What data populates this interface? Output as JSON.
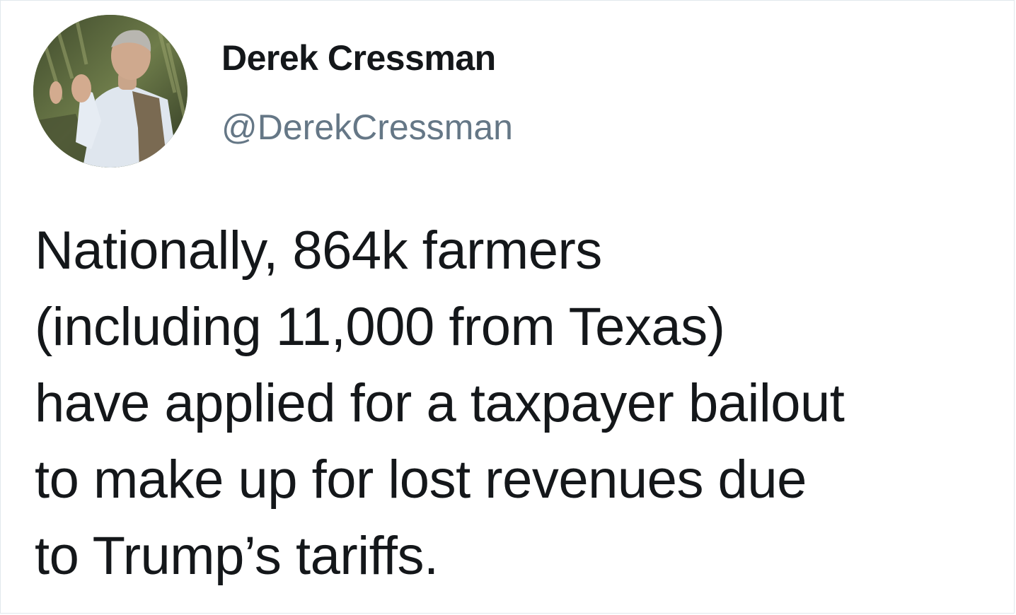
{
  "author": {
    "name": "Derek Cressman",
    "handle": "@DerekCressman",
    "avatar_icon": "profile-photo"
  },
  "tweet": {
    "lines": [
      "Nationally, 864k farmers",
      "(including 11,000 from Texas)",
      "have applied for a taxpayer bailout",
      "to make up for lost revenues due",
      "to Trump’s tariffs."
    ]
  },
  "colors": {
    "name": "#14171a",
    "handle": "#657786",
    "text": "#14171a",
    "background": "#ffffff"
  }
}
